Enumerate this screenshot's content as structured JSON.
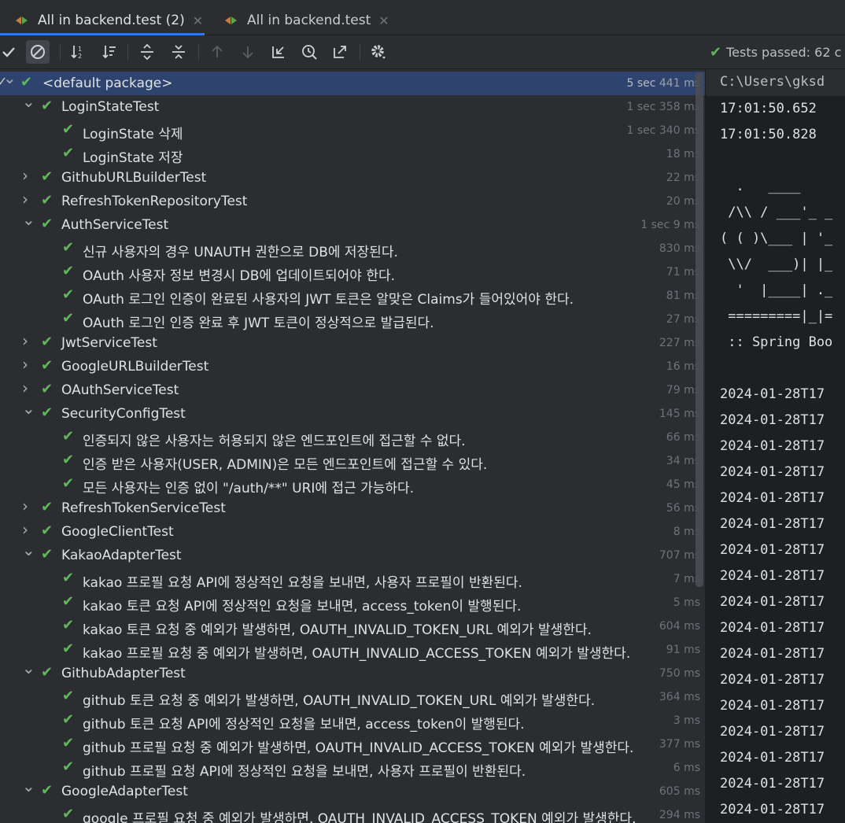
{
  "tabs": [
    {
      "label": "All in backend.test (2)",
      "close": "✕"
    },
    {
      "label": "All in backend.test",
      "close": "✕"
    }
  ],
  "toolbar": {
    "status_text": "Tests passed: 62 c",
    "icons": [
      "check-icon",
      "cancel-icon",
      "sort-alpha-icon",
      "sort-duration-icon",
      "expand-all-icon",
      "collapse-all-icon",
      "prev-failed-icon",
      "next-failed-icon",
      "import-tests-icon",
      "history-icon",
      "export-icon",
      "settings-icon"
    ]
  },
  "tree": [
    {
      "label": "<default package>",
      "sec": "5 sec",
      "ms": "441 ms",
      "level": 0,
      "chevron": "down",
      "selected": true
    },
    {
      "label": "LoginStateTest",
      "sec": "1 sec",
      "ms": "358 ms",
      "level": 1,
      "chevron": "down"
    },
    {
      "label": "LoginState 삭제",
      "sec": "1 sec",
      "ms": "340 ms",
      "level": 2
    },
    {
      "label": "LoginState 저장",
      "sec": "",
      "ms": "18 ms",
      "level": 2
    },
    {
      "label": "GithubURLBuilderTest",
      "sec": "",
      "ms": "22 ms",
      "level": 1,
      "chevron": "right"
    },
    {
      "label": "RefreshTokenRepositoryTest",
      "sec": "",
      "ms": "20 ms",
      "level": 1,
      "chevron": "right"
    },
    {
      "label": "AuthServiceTest",
      "sec": "1 sec",
      "ms": "9 ms",
      "level": 1,
      "chevron": "down"
    },
    {
      "label": "신규 사용자의 경우 UNAUTH 권한으로 DB에 저장된다.",
      "sec": "",
      "ms": "830 ms",
      "level": 2
    },
    {
      "label": "OAuth 사용자 정보 변경시 DB에 업데이트되어야 한다.",
      "sec": "",
      "ms": "71 ms",
      "level": 2
    },
    {
      "label": "OAuth 로그인 인증이 완료된 사용자의 JWT 토큰은 알맞은 Claims가 들어있어야 한다.",
      "sec": "",
      "ms": "81 ms",
      "level": 2
    },
    {
      "label": "OAuth 로그인 인증 완료 후 JWT 토큰이 정상적으로 발급된다.",
      "sec": "",
      "ms": "27 ms",
      "level": 2
    },
    {
      "label": "JwtServiceTest",
      "sec": "",
      "ms": "227 ms",
      "level": 1,
      "chevron": "right"
    },
    {
      "label": "GoogleURLBuilderTest",
      "sec": "",
      "ms": "16 ms",
      "level": 1,
      "chevron": "right"
    },
    {
      "label": "OAuthServiceTest",
      "sec": "",
      "ms": "79 ms",
      "level": 1,
      "chevron": "right"
    },
    {
      "label": "SecurityConfigTest",
      "sec": "",
      "ms": "145 ms",
      "level": 1,
      "chevron": "down"
    },
    {
      "label": "인증되지 않은 사용자는 허용되지 않은 엔드포인트에 접근할 수 없다.",
      "sec": "",
      "ms": "66 ms",
      "level": 2
    },
    {
      "label": "인증 받은 사용자(USER, ADMIN)은 모든 엔드포인트에 접근할 수 있다.",
      "sec": "",
      "ms": "34 ms",
      "level": 2
    },
    {
      "label": "모든 사용자는 인증 없이 \"/auth/**\" URI에 접근 가능하다.",
      "sec": "",
      "ms": "45 ms",
      "level": 2
    },
    {
      "label": "RefreshTokenServiceTest",
      "sec": "",
      "ms": "56 ms",
      "level": 1,
      "chevron": "right"
    },
    {
      "label": "GoogleClientTest",
      "sec": "",
      "ms": "8 ms",
      "level": 1,
      "chevron": "right"
    },
    {
      "label": "KakaoAdapterTest",
      "sec": "",
      "ms": "707 ms",
      "level": 1,
      "chevron": "down"
    },
    {
      "label": "kakao 프로필 요청 API에 정상적인 요청을 보내면, 사용자 프로필이 반환된다.",
      "sec": "",
      "ms": "7 ms",
      "level": 2
    },
    {
      "label": "kakao 토큰 요청 API에 정상적인 요청을 보내면, access_token이 발행된다.",
      "sec": "",
      "ms": "5 ms",
      "level": 2
    },
    {
      "label": "kakao 토큰 요청 중 예외가 발생하면, OAUTH_INVALID_TOKEN_URL 예외가 발생한다.",
      "sec": "",
      "ms": "604 ms",
      "level": 2
    },
    {
      "label": "kakao 프로필 요청 중 예외가 발생하면, OAUTH_INVALID_ACCESS_TOKEN 예외가 발생한다.",
      "sec": "",
      "ms": "91 ms",
      "level": 2
    },
    {
      "label": "GithubAdapterTest",
      "sec": "",
      "ms": "750 ms",
      "level": 1,
      "chevron": "down"
    },
    {
      "label": "github 토큰 요청 중 예외가 발생하면, OAUTH_INVALID_TOKEN_URL 예외가 발생한다.",
      "sec": "",
      "ms": "364 ms",
      "level": 2
    },
    {
      "label": "github 토큰 요청 API에 정상적인 요청을 보내면, access_token이 발행된다.",
      "sec": "",
      "ms": "3 ms",
      "level": 2
    },
    {
      "label": "github 프로필 요청 중 예외가 발생하면, OAUTH_INVALID_ACCESS_TOKEN 예외가 발생한다.",
      "sec": "",
      "ms": "377 ms",
      "level": 2
    },
    {
      "label": "github 프로필 요청 API에 정상적인 요청을 보내면, 사용자 프로필이 반환된다.",
      "sec": "",
      "ms": "6 ms",
      "level": 2
    },
    {
      "label": "GoogleAdapterTest",
      "sec": "",
      "ms": "605 ms",
      "level": 1,
      "chevron": "down"
    },
    {
      "label": "google 프로필 요청 중 예외가 발생하면, OAUTH_INVALID_ACCESS_TOKEN 예외가 발생한다.",
      "sec": "",
      "ms": "294 ms",
      "level": 2
    }
  ],
  "console": {
    "path": "C:\\Users\\gksd",
    "lines": [
      "17:01:50.652",
      "17:01:50.828",
      "",
      "  .   ____",
      " /\\\\ / ___'_ _",
      "( ( )\\___ | '_",
      " \\\\/  ___)| |_",
      "  '  |____| ._",
      " =========|_|=",
      " :: Spring Boo",
      "",
      "2024-01-28T17",
      "2024-01-28T17",
      "2024-01-28T17",
      "2024-01-28T17",
      "2024-01-28T17",
      "2024-01-28T17",
      "2024-01-28T17",
      "2024-01-28T17",
      "2024-01-28T17",
      "2024-01-28T17",
      "2024-01-28T17",
      "2024-01-28T17",
      "2024-01-28T17",
      "2024-01-28T17",
      "2024-01-28T17",
      "2024-01-28T17",
      "2024-01-28T17"
    ]
  },
  "colors": {
    "pass": "#5fb85a",
    "selection": "#2e436e",
    "background": "#2b2d30",
    "console_bg": "#1e1f22",
    "tab_underline": "#3574f0"
  }
}
